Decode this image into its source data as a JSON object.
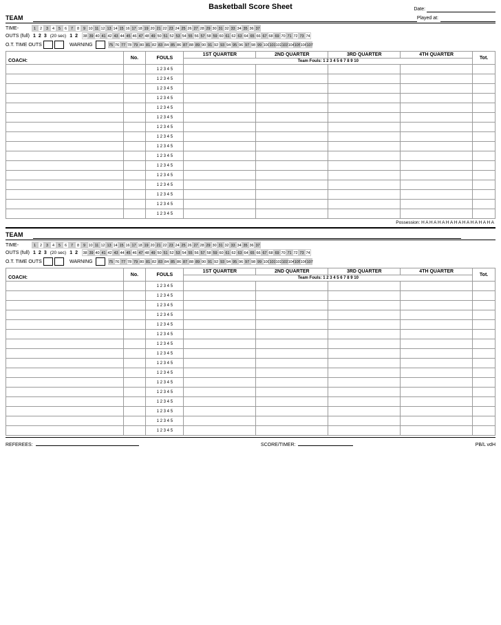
{
  "page": {
    "title": "Basketball Score Sheet",
    "date_label": "Date:",
    "played_at_label": "Played at:",
    "team_label": "TEAM",
    "time_label": "TIME-",
    "outs_full_label": "OUTS (full)",
    "outs_numbers": [
      "1",
      "2",
      "3"
    ],
    "sec_label": "(20 sec)",
    "ots_label": "1",
    "ots_label2": "2",
    "ot_label": "O.T. TIME OUTS",
    "warning_label": "WARNING",
    "coach_label": "COACH:",
    "no_label": "No.",
    "fouls_label": "FOULS",
    "q1_label": "1ST QUARTER",
    "q2_label": "2ND QUARTER",
    "q3_label": "3RD QUARTER",
    "q4_label": "4TH QUARTER",
    "tot_label": "Tot.",
    "team_fouls_label": "Team Fouls: 1 2 3 4 5 6 7 8 9 10",
    "fouls_row": "1 2 3 4 5",
    "possession_label": "Possession: H  A  H  A  H  A  H  A  H  A  H  A  H  A  H  A  H  A",
    "time_numbers_1": [
      "1",
      "2",
      "3",
      "4",
      "5",
      "6",
      "7",
      "8",
      "9",
      "10",
      "11",
      "12",
      "13",
      "14",
      "15",
      "16",
      "17",
      "18",
      "19",
      "20",
      "21",
      "22",
      "23",
      "24",
      "25",
      "26",
      "27",
      "28",
      "29",
      "30",
      "31",
      "32",
      "33",
      "34",
      "35",
      "36",
      "37"
    ],
    "time_numbers_2": [
      "38",
      "39",
      "40",
      "41",
      "42",
      "43",
      "44",
      "45",
      "46",
      "47",
      "48",
      "49",
      "50",
      "51",
      "52",
      "53",
      "54",
      "55",
      "56",
      "57",
      "58",
      "59",
      "60",
      "61",
      "62",
      "63",
      "64",
      "65",
      "66",
      "67",
      "68",
      "69",
      "70",
      "71",
      "72",
      "73",
      "74"
    ],
    "time_numbers_3": [
      "75",
      "76",
      "77",
      "78",
      "79",
      "80",
      "81",
      "82",
      "83",
      "84",
      "85",
      "86",
      "87",
      "88",
      "89",
      "90",
      "91",
      "92",
      "93",
      "94",
      "95",
      "96",
      "97",
      "98",
      "99",
      "100",
      "101",
      "102",
      "103",
      "104",
      "105",
      "106",
      "107"
    ],
    "player_rows": 16,
    "referees_label": "REFEREES:",
    "score_timer_label": "SCORE/TIMER:",
    "pb_label": "PB/L vdH"
  }
}
